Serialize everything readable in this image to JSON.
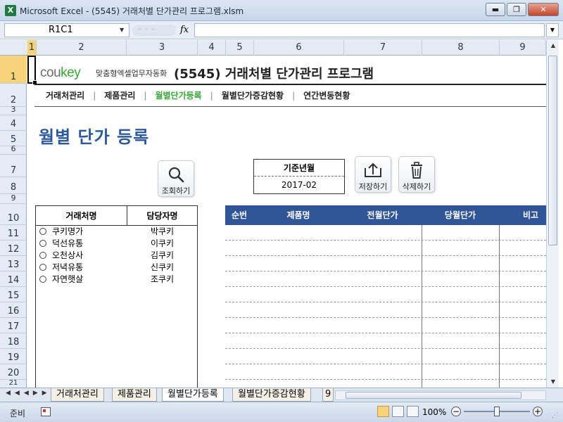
{
  "window": {
    "title": "Microsoft Excel - (5545) 거래처별 단가관리 프로그램.xlsm",
    "minimize": "▬",
    "restore": "❐",
    "close": "✕"
  },
  "formula_bar": {
    "name_box": "R1C1",
    "fx_label": "fx",
    "formula": ""
  },
  "columns": [
    "1",
    "2",
    "3",
    "4",
    "5",
    "6",
    "7",
    "8",
    "9"
  ],
  "rows": [
    "1",
    "2",
    "3",
    "4",
    "5",
    "6",
    "7",
    "8",
    "9",
    "10",
    "11",
    "12",
    "13",
    "14",
    "15",
    "16",
    "17",
    "18",
    "19",
    "20",
    "21"
  ],
  "header": {
    "logo_brand": "cou",
    "logo_key": "key",
    "logo_tagline": "맞춤형엑셀업무자동화",
    "title": "(5545) 거래처별 단가관리 프로그램"
  },
  "menu": [
    {
      "label": "거래처관리"
    },
    {
      "label": "제품관리"
    },
    {
      "label": "월별단가등록"
    },
    {
      "label": "월별단가증감현황"
    },
    {
      "label": "연간변동현황"
    }
  ],
  "page_heading": "월별 단가 등록",
  "buttons": {
    "search": "조회하기",
    "save": "저장하기",
    "delete": "삭제하기"
  },
  "base_month": {
    "label": "기준년월",
    "value": "2017-02"
  },
  "client_table": {
    "headers": [
      "거래처명",
      "담당자명"
    ],
    "rows": [
      {
        "name": "쿠키명가",
        "manager": "박쿠키"
      },
      {
        "name": "덕선유통",
        "manager": "이쿠키"
      },
      {
        "name": "오천상사",
        "manager": "김쿠키"
      },
      {
        "name": "저녁유통",
        "manager": "신쿠키"
      },
      {
        "name": "자연햇살",
        "manager": "조쿠키"
      }
    ]
  },
  "price_table": {
    "headers": [
      "순번",
      "제품명",
      "전월단가",
      "당월단가",
      "비고"
    ]
  },
  "sheet_tabs": [
    "거래처관리",
    "제품관리",
    "월별단가등록",
    "월별단가증감현황",
    "9"
  ],
  "status": {
    "ready": "준비",
    "zoom": "100%",
    "zoom_minus": "−",
    "zoom_plus": "+"
  },
  "colors": {
    "accent_green": "#3aa33a",
    "heading_blue": "#2e5a9b",
    "table_header_blue": "#2f5597"
  }
}
